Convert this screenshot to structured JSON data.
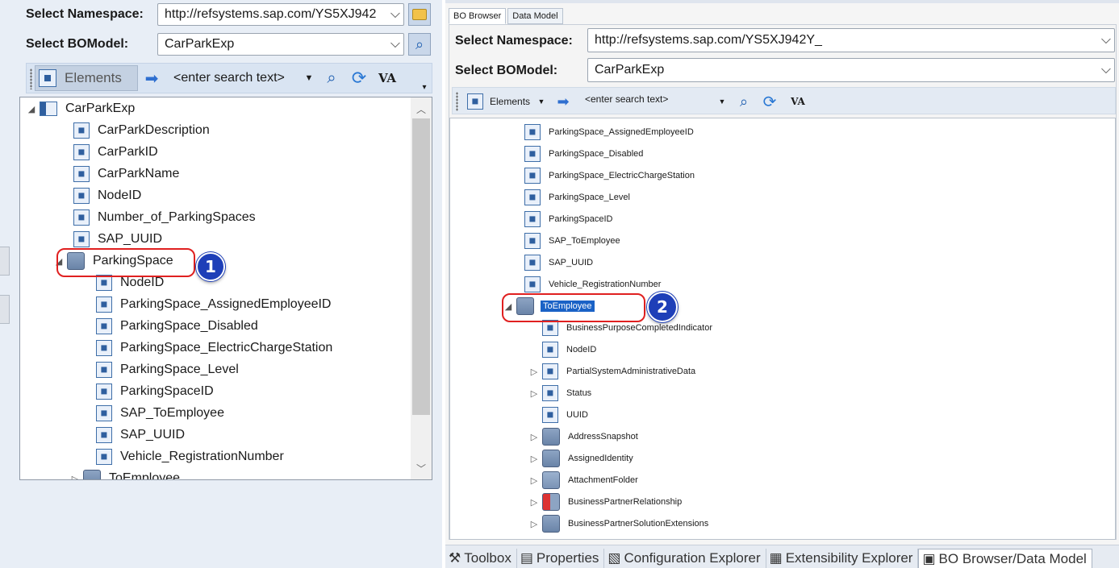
{
  "left": {
    "namespace_label": "Select Namespace:",
    "namespace_value": "http://refsystems.sap.com/YS5XJ942",
    "bomodel_label": "Select BOModel:",
    "bomodel_value": "CarParkExp",
    "toolbar": {
      "elements_label": "Elements",
      "search_placeholder": "<enter search text>",
      "va_label": "VA"
    },
    "tree": {
      "root": "CarParkExp",
      "root_children": [
        "CarParkDescription",
        "CarParkID",
        "CarParkName",
        "NodeID",
        "Number_of_ParkingSpaces",
        "SAP_UUID"
      ],
      "parking_space": "ParkingSpace",
      "parking_children": [
        "NodeID",
        "ParkingSpace_AssignedEmployeeID",
        "ParkingSpace_Disabled",
        "ParkingSpace_ElectricChargeStation",
        "ParkingSpace_Level",
        "ParkingSpaceID",
        "SAP_ToEmployee",
        "SAP_UUID",
        "Vehicle_RegistrationNumber"
      ],
      "partial_last": "ToEmployee"
    },
    "badge": "1"
  },
  "right": {
    "tabs": [
      "BO Browser",
      "Data Model"
    ],
    "namespace_label": "Select Namespace:",
    "namespace_value": "http://refsystems.sap.com/YS5XJ942Y_",
    "bomodel_label": "Select BOModel:",
    "bomodel_value": "CarParkExp",
    "toolbar": {
      "elements_label": "Elements",
      "search_placeholder": "<enter search text>",
      "va_label": "VA"
    },
    "tree": {
      "parking_children": [
        "ParkingSpace_AssignedEmployeeID",
        "ParkingSpace_Disabled",
        "ParkingSpace_ElectricChargeStation",
        "ParkingSpace_Level",
        "ParkingSpaceID",
        "SAP_ToEmployee",
        "SAP_UUID",
        "Vehicle_RegistrationNumber"
      ],
      "selected": "ToEmployee",
      "to_employee_children": [
        {
          "label": "BusinessPurposeCompletedIndicator",
          "kind": "element",
          "expandable": false
        },
        {
          "label": "NodeID",
          "kind": "element",
          "expandable": false
        },
        {
          "label": "PartialSystemAdministrativeData",
          "kind": "element",
          "expandable": true
        },
        {
          "label": "Status",
          "kind": "element",
          "expandable": true
        },
        {
          "label": "UUID",
          "kind": "element",
          "expandable": false
        },
        {
          "label": "AddressSnapshot",
          "kind": "association",
          "expandable": true
        },
        {
          "label": "AssignedIdentity",
          "kind": "association",
          "expandable": true
        },
        {
          "label": "AttachmentFolder",
          "kind": "folder",
          "expandable": true
        },
        {
          "label": "BusinessPartnerRelationship",
          "kind": "relationship",
          "expandable": true
        },
        {
          "label": "BusinessPartnerSolutionExtensions",
          "kind": "association",
          "expandable": true
        }
      ]
    },
    "badge": "2",
    "bottom_tabs": [
      {
        "label": "Toolbox",
        "icon": "toolbox-icon"
      },
      {
        "label": "Properties",
        "icon": "properties-icon"
      },
      {
        "label": "Configuration Explorer",
        "icon": "configuration-icon"
      },
      {
        "label": "Extensibility Explorer",
        "icon": "extensibility-icon"
      },
      {
        "label": "BO Browser/Data Model",
        "icon": "bo-browser-icon"
      }
    ]
  },
  "colors": {
    "selection": "#1a62c6",
    "callout": "#e02020",
    "badge": "#1e3fb8"
  }
}
